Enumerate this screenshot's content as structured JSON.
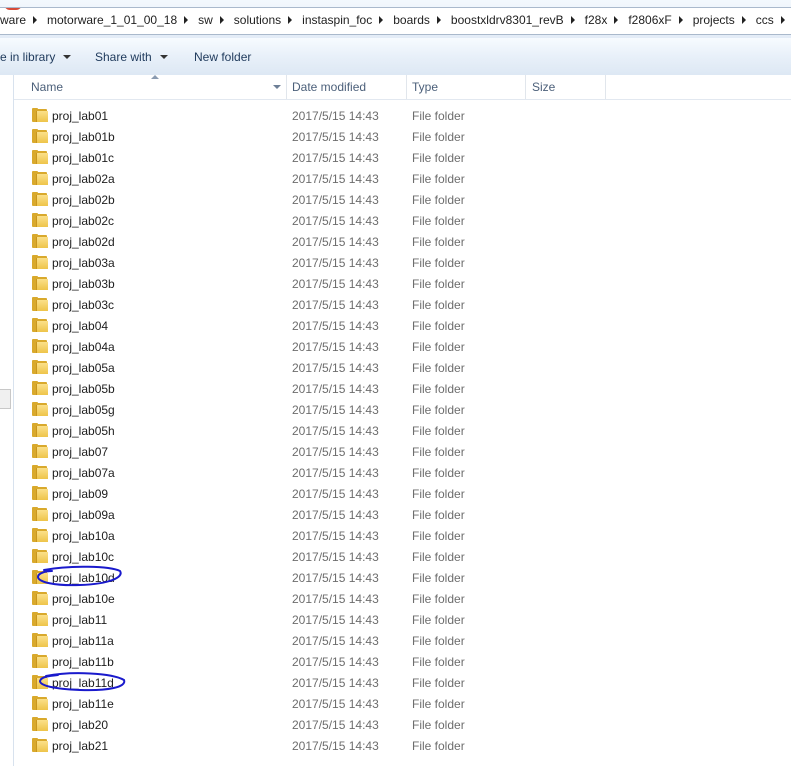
{
  "breadcrumb": [
    "ware",
    "motorware_1_01_00_18",
    "sw",
    "solutions",
    "instaspin_foc",
    "boards",
    "boostxldrv8301_revB",
    "f28x",
    "f2806xF",
    "projects",
    "ccs"
  ],
  "toolbar": {
    "include_in_library": "e in library",
    "share_with": "Share with",
    "new_folder": "New folder"
  },
  "columns": {
    "name": "Name",
    "date_modified": "Date modified",
    "type": "Type",
    "size": "Size"
  },
  "files": [
    {
      "name": "proj_lab01",
      "date": "2017/5/15 14:43",
      "type": "File folder"
    },
    {
      "name": "proj_lab01b",
      "date": "2017/5/15 14:43",
      "type": "File folder"
    },
    {
      "name": "proj_lab01c",
      "date": "2017/5/15 14:43",
      "type": "File folder"
    },
    {
      "name": "proj_lab02a",
      "date": "2017/5/15 14:43",
      "type": "File folder"
    },
    {
      "name": "proj_lab02b",
      "date": "2017/5/15 14:43",
      "type": "File folder"
    },
    {
      "name": "proj_lab02c",
      "date": "2017/5/15 14:43",
      "type": "File folder"
    },
    {
      "name": "proj_lab02d",
      "date": "2017/5/15 14:43",
      "type": "File folder"
    },
    {
      "name": "proj_lab03a",
      "date": "2017/5/15 14:43",
      "type": "File folder"
    },
    {
      "name": "proj_lab03b",
      "date": "2017/5/15 14:43",
      "type": "File folder"
    },
    {
      "name": "proj_lab03c",
      "date": "2017/5/15 14:43",
      "type": "File folder"
    },
    {
      "name": "proj_lab04",
      "date": "2017/5/15 14:43",
      "type": "File folder"
    },
    {
      "name": "proj_lab04a",
      "date": "2017/5/15 14:43",
      "type": "File folder"
    },
    {
      "name": "proj_lab05a",
      "date": "2017/5/15 14:43",
      "type": "File folder"
    },
    {
      "name": "proj_lab05b",
      "date": "2017/5/15 14:43",
      "type": "File folder"
    },
    {
      "name": "proj_lab05g",
      "date": "2017/5/15 14:43",
      "type": "File folder"
    },
    {
      "name": "proj_lab05h",
      "date": "2017/5/15 14:43",
      "type": "File folder"
    },
    {
      "name": "proj_lab07",
      "date": "2017/5/15 14:43",
      "type": "File folder"
    },
    {
      "name": "proj_lab07a",
      "date": "2017/5/15 14:43",
      "type": "File folder"
    },
    {
      "name": "proj_lab09",
      "date": "2017/5/15 14:43",
      "type": "File folder"
    },
    {
      "name": "proj_lab09a",
      "date": "2017/5/15 14:43",
      "type": "File folder"
    },
    {
      "name": "proj_lab10a",
      "date": "2017/5/15 14:43",
      "type": "File folder"
    },
    {
      "name": "proj_lab10c",
      "date": "2017/5/15 14:43",
      "type": "File folder"
    },
    {
      "name": "proj_lab10d",
      "date": "2017/5/15 14:43",
      "type": "File folder"
    },
    {
      "name": "proj_lab10e",
      "date": "2017/5/15 14:43",
      "type": "File folder"
    },
    {
      "name": "proj_lab11",
      "date": "2017/5/15 14:43",
      "type": "File folder"
    },
    {
      "name": "proj_lab11a",
      "date": "2017/5/15 14:43",
      "type": "File folder"
    },
    {
      "name": "proj_lab11b",
      "date": "2017/5/15 14:43",
      "type": "File folder"
    },
    {
      "name": "proj_lab11d",
      "date": "2017/5/15 14:43",
      "type": "File folder"
    },
    {
      "name": "proj_lab11e",
      "date": "2017/5/15 14:43",
      "type": "File folder"
    },
    {
      "name": "proj_lab20",
      "date": "2017/5/15 14:43",
      "type": "File folder"
    },
    {
      "name": "proj_lab21",
      "date": "2017/5/15 14:43",
      "type": "File folder"
    }
  ],
  "annotation_color": "#1a1acc"
}
